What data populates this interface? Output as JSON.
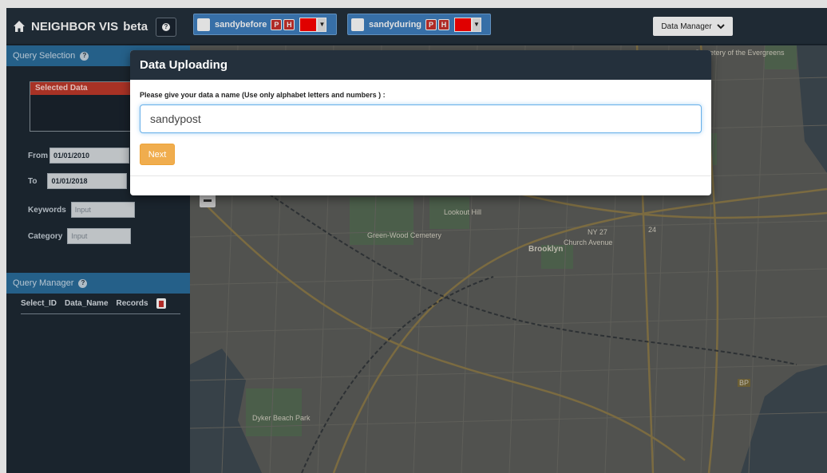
{
  "app": {
    "brand": "NEIGHBOR VIS",
    "beta": "beta",
    "help_glyph": "?"
  },
  "datasets": [
    {
      "name": "sandybefore",
      "p": "P",
      "h": "H",
      "color": "#ff0000",
      "dropdown_glyph": "▼"
    },
    {
      "name": "sandyduring",
      "p": "P",
      "h": "H",
      "color": "#ff0000",
      "dropdown_glyph": "▼"
    }
  ],
  "data_manager": {
    "label": "Data Manager"
  },
  "query_selection": {
    "title": "Query Selection",
    "selected_data_header": "Selected Data",
    "from_label": "From",
    "from_value": "01/01/2010",
    "to_label": "To",
    "to_value": "01/01/2018",
    "keywords_label": "Keywords",
    "keywords_placeholder": "Input",
    "category_label": "Category",
    "category_placeholder": "Input"
  },
  "query_manager": {
    "title": "Query Manager",
    "columns": [
      "Select_ID",
      "Data_Name",
      "Records"
    ]
  },
  "map": {
    "labels": [
      "Green-Wood Cemetery",
      "Brooklyn",
      "Church Avenue",
      "NY 27",
      "Lookout Hill",
      "Dyker Beach Park",
      "Cemetery of the Evergreens",
      "BP",
      "24"
    ]
  },
  "modal": {
    "title": "Data Uploading",
    "prompt": "Please give your data a name (Use only alphabet letters and numbers ) :",
    "input_value": "sandypost",
    "next_label": "Next"
  },
  "colors": {
    "navbar": "#24303c",
    "accent_blue": "#3f7fbf",
    "warning": "#f0ad4e",
    "danger": "#c9302c"
  }
}
